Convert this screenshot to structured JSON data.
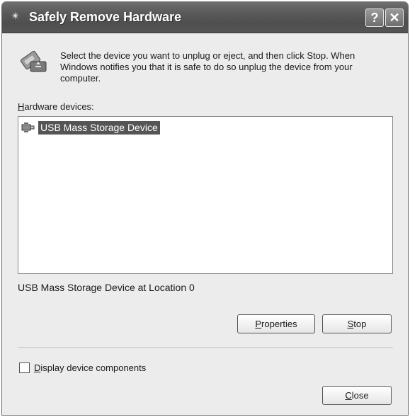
{
  "window": {
    "title": "Safely Remove Hardware",
    "help_label": "?",
    "close_glyph": "✕"
  },
  "instructions": "Select the device you want to unplug or eject, and then click Stop. When Windows notifies you that it is safe to do so unplug the device from your computer.",
  "hardware_label": {
    "accel": "H",
    "rest": "ardware devices:"
  },
  "devices": [
    {
      "name": "USB Mass Storage Device",
      "selected": true,
      "icon": "usb-device-icon"
    }
  ],
  "location_text": "USB Mass Storage Device at Location 0",
  "buttons": {
    "properties": {
      "accel": "P",
      "rest": "roperties"
    },
    "stop": {
      "accel": "S",
      "rest": "top"
    },
    "close": {
      "accel": "C",
      "rest": "lose"
    }
  },
  "display_components": {
    "accel": "D",
    "rest": "isplay device components",
    "checked": false
  },
  "colors": {
    "titlebar": "#5a5a5a",
    "selection": "#555555",
    "dialog_bg": "#ececec"
  }
}
